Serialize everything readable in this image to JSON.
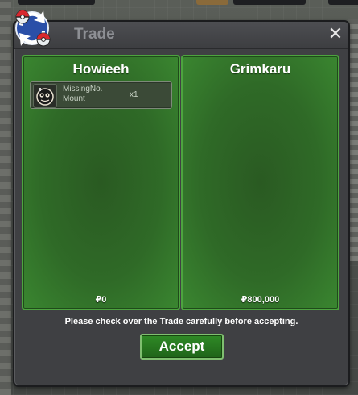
{
  "background": {
    "tags": [
      "",
      "",
      ""
    ]
  },
  "window": {
    "title": "Trade",
    "close_glyph": "✕",
    "icon": "trade-swap-icon"
  },
  "left_panel": {
    "player": "Howieeh",
    "money": "₽0",
    "items": [
      {
        "name": "MissingNo. Mount",
        "qty": "x1",
        "icon": "missingno-mount-icon"
      }
    ]
  },
  "right_panel": {
    "player": "Grimkaru",
    "money": "₽800,000",
    "items": []
  },
  "notice": "Please check over the Trade carefully before accepting.",
  "accept_label": "Accept",
  "colors": {
    "panel_green": "#2f6a27",
    "panel_border": "#4da43f",
    "accept_green": "#2f8a26",
    "window_bg": "#3f4043"
  }
}
